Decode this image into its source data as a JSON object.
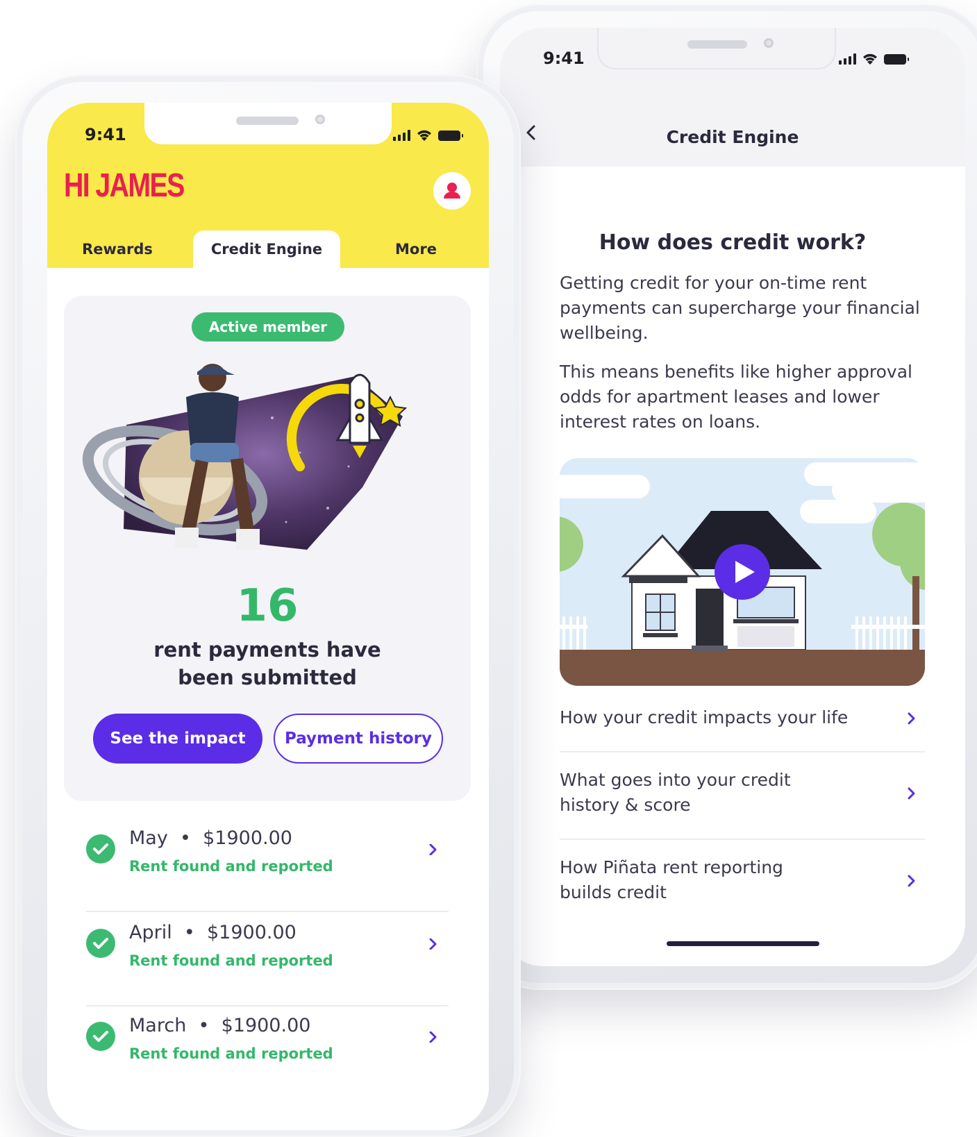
{
  "colors": {
    "brand_yellow": "#f9e94a",
    "greeting_red": "#e8214e",
    "accent_purple": "#5b2de6",
    "success_green": "#3cba72"
  },
  "left_phone": {
    "status_time": "9:41",
    "greeting": "HI JAMES",
    "tabs": [
      {
        "label": "Rewards",
        "active": false
      },
      {
        "label": "Credit Engine",
        "active": true
      },
      {
        "label": "More",
        "active": false
      }
    ],
    "card": {
      "badge": "Active member",
      "count": "16",
      "count_label_line1": "rent payments have",
      "count_label_line2": "been submitted",
      "primary_button": "See the impact",
      "secondary_button": "Payment history"
    },
    "payments": [
      {
        "month": "May",
        "amount": "$1900.00",
        "status": "Rent found and reported"
      },
      {
        "month": "April",
        "amount": "$1900.00",
        "status": "Rent found and reported"
      },
      {
        "month": "March",
        "amount": "$1900.00",
        "status": "Rent found and reported"
      }
    ],
    "separator": "•"
  },
  "right_phone": {
    "status_time": "9:41",
    "nav_title": "Credit Engine",
    "info_title": "How does credit work?",
    "paragraph_1": "Getting credit for your on-time rent payments can supercharge your financial wellbeing.",
    "paragraph_2": "This means benefits like higher approval odds for apartment leases and lower interest rates on loans.",
    "faq_items": [
      {
        "line1": "How your credit impacts your life",
        "line2": ""
      },
      {
        "line1": "What goes into your credit",
        "line2": "history & score"
      },
      {
        "line1": "How Piñata rent reporting",
        "line2": "builds credit"
      }
    ]
  }
}
